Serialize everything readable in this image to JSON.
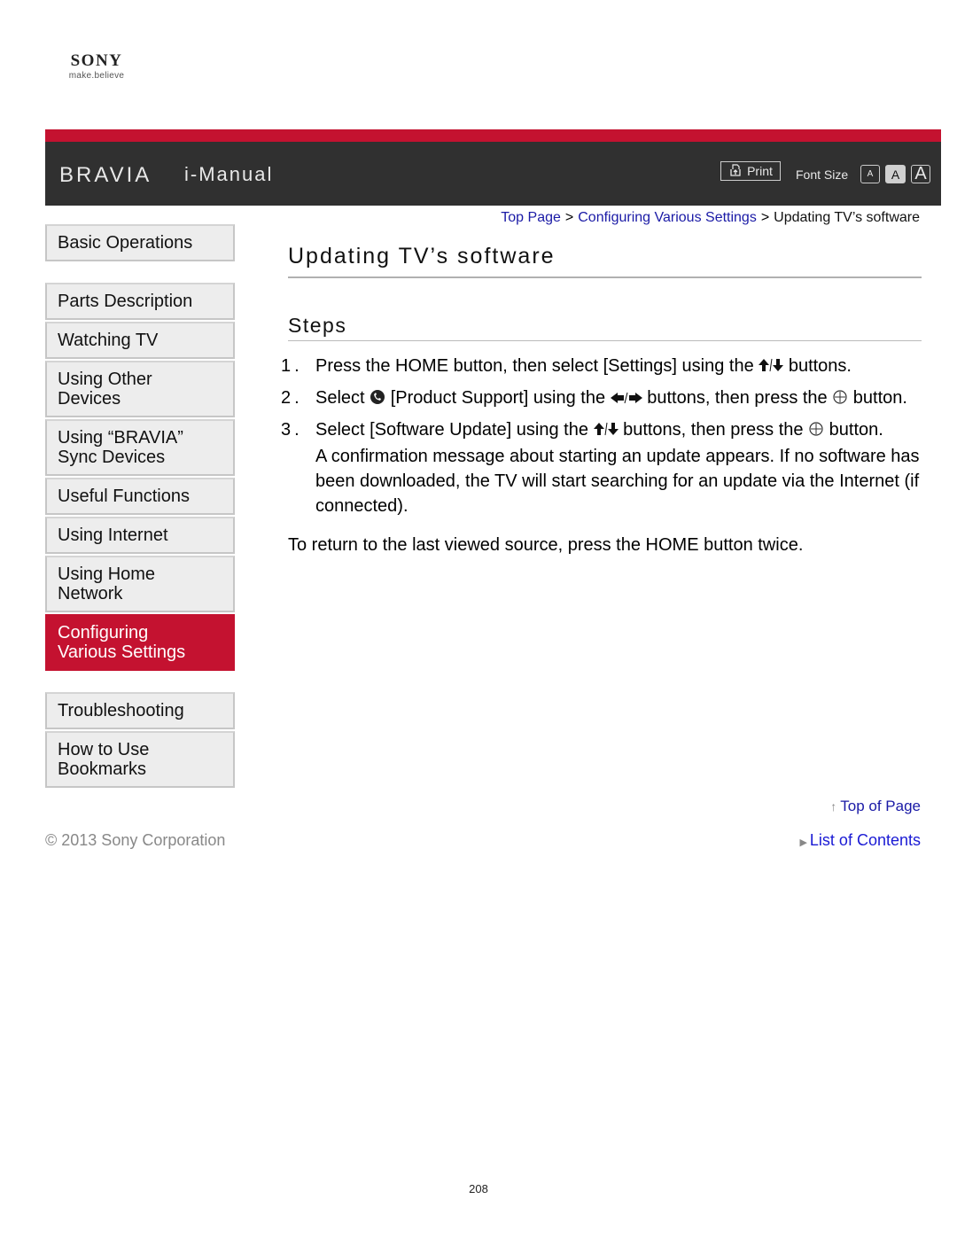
{
  "logo": {
    "brand": "SONY",
    "tagline": "make.believe"
  },
  "header": {
    "product": "BRAVIA",
    "title": "i-Manual",
    "print_label": "Print",
    "font_size_label": "Font Size",
    "font_size_options": [
      "A",
      "A",
      "A"
    ],
    "font_size_selected": "medium",
    "accent_color": "#c41230"
  },
  "breadcrumb": {
    "items": [
      {
        "label": "Top Page"
      },
      {
        "label": "Configuring Various Settings"
      }
    ],
    "separator": ">",
    "current": "Updating TV’s software"
  },
  "sidebar": {
    "group1": [
      {
        "label": "Basic Operations"
      }
    ],
    "group2": [
      {
        "label": "Parts Description"
      },
      {
        "label": "Watching TV"
      },
      {
        "label": "Using Other Devices"
      },
      {
        "label": "Using “BRAVIA” Sync Devices"
      },
      {
        "label": "Useful Functions"
      },
      {
        "label": "Using Internet"
      },
      {
        "label": "Using Home Network"
      },
      {
        "label": "Configuring Various Settings",
        "active": true
      }
    ],
    "group3": [
      {
        "label": "Troubleshooting"
      },
      {
        "label": "How to Use Bookmarks"
      }
    ]
  },
  "main": {
    "title": "Updating TV’s software",
    "section": "Steps",
    "steps": [
      {
        "num": "1.",
        "parts": [
          "Press the HOME button, then select [Settings] using the ",
          " buttons."
        ],
        "icons": [
          "up-down-arrows-icon"
        ]
      },
      {
        "num": "2.",
        "parts": [
          "Select ",
          " [Product Support] using the ",
          " buttons, then press the ",
          " button."
        ],
        "icons": [
          "product-support-icon",
          "left-right-arrows-icon",
          "enter-button-icon"
        ]
      },
      {
        "num": "3.",
        "parts": [
          "Select [Software Update] using the ",
          " buttons, then press the ",
          " button."
        ],
        "icons": [
          "up-down-arrows-icon",
          "enter-button-icon"
        ],
        "note": "A confirmation message about starting an update appears. If no software has been downloaded, the TV will start searching for an update via the Internet (if connected)."
      }
    ],
    "return_note": "To return to the last viewed source, press the HOME button twice."
  },
  "footer": {
    "top_of_page": "Top of Page",
    "list_of_contents": "List of Contents",
    "copyright": "© 2013 Sony Corporation",
    "page_number": "208"
  }
}
